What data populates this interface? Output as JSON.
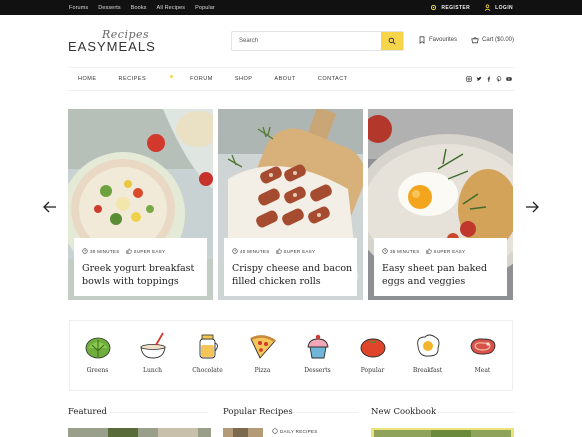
{
  "topbar": {
    "links": [
      "Forums",
      "Desserts",
      "Books",
      "All Recipes",
      "Popular"
    ],
    "register": "REGISTER",
    "login": "LOGIN"
  },
  "logo": {
    "script": "Recipes",
    "main": "EASYMEALS"
  },
  "search": {
    "placeholder": "Search"
  },
  "header": {
    "favourites": "Favourites",
    "cart": "Cart ($0.00)"
  },
  "nav": {
    "items": [
      "HOME",
      "RECIPES",
      "FORUM",
      "SHOP",
      "ABOUT",
      "CONTACT"
    ]
  },
  "slides": [
    {
      "time": "30 MINUTES",
      "level": "SUPER EASY",
      "title": "Greek yogurt breakfast bowls with toppings"
    },
    {
      "time": "40 MINUTES",
      "level": "SUPER EASY",
      "title": "Crispy cheese and bacon filled chicken rolls"
    },
    {
      "time": "35 MINUTES",
      "level": "SUPER EASY",
      "title": "Easy sheet pan baked eggs and veggies"
    }
  ],
  "categories": [
    "Greens",
    "Lunch",
    "Chocolate",
    "Pizza",
    "Desserts",
    "Popular",
    "Breakfast",
    "Meat"
  ],
  "sections": {
    "featured": "Featured",
    "popular": "Popular Recipes",
    "cookbook": "New Cookbook",
    "daily": "DAILY RECIPES"
  },
  "colors": {
    "accent": "#f6d54a",
    "topbar": "#111111",
    "text": "#222222"
  },
  "icons": {
    "register": "gear-icon",
    "login": "user-icon",
    "search": "search-icon",
    "favourites": "bookmark-icon",
    "cart": "basket-icon",
    "social": [
      "instagram-icon",
      "twitter-icon",
      "facebook-icon",
      "pinterest-icon",
      "youtube-icon"
    ],
    "time": "clock-icon",
    "level": "thumb-icon",
    "prev": "arrow-left-icon",
    "next": "arrow-right-icon"
  }
}
